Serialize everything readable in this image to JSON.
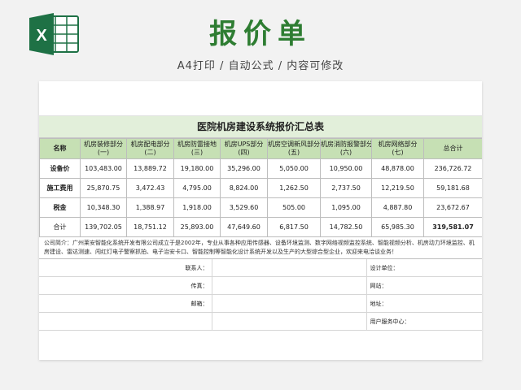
{
  "page": {
    "title": "报价单",
    "subtitle": "A4打印 / 自动公式 / 内容可修改",
    "excel_icon_letter": "X"
  },
  "sheet": {
    "table_title": "医院机房建设系统报价汇总表",
    "headers": [
      {
        "top": "名称",
        "bottom": ""
      },
      {
        "top": "机房装修部分",
        "bottom": "(一)"
      },
      {
        "top": "机房配电部分",
        "bottom": "(二)"
      },
      {
        "top": "机房防雷接地",
        "bottom": "(三)"
      },
      {
        "top": "机房UPS部分",
        "bottom": "(四)"
      },
      {
        "top": "机房空调新风部分",
        "bottom": "(五)"
      },
      {
        "top": "机房消防报警部分",
        "bottom": "(六)"
      },
      {
        "top": "机房网络部分",
        "bottom": "(七)"
      },
      {
        "top": "总合计",
        "bottom": ""
      }
    ],
    "rows": [
      {
        "label": "设备价",
        "values": [
          "103,483.00",
          "13,889.72",
          "19,180.00",
          "35,296.00",
          "5,050.00",
          "10,950.00",
          "48,878.00",
          "236,726.72"
        ]
      },
      {
        "label": "施工费用",
        "values": [
          "25,870.75",
          "3,472.43",
          "4,795.00",
          "8,824.00",
          "1,262.50",
          "2,737.50",
          "12,219.50",
          "59,181.68"
        ]
      },
      {
        "label": "税金",
        "values": [
          "10,348.30",
          "1,388.97",
          "1,918.00",
          "3,529.60",
          "505.00",
          "1,095.00",
          "4,887.80",
          "23,672.67"
        ]
      },
      {
        "label": "合计",
        "values": [
          "139,702.05",
          "18,751.12",
          "25,893.00",
          "47,649.60",
          "6,817.50",
          "14,782.50",
          "65,985.30",
          "319,581.07"
        ]
      }
    ],
    "note": "公司简介：广州莱安智能化系统开发有限公司成立于是2002年，专业从事各种应用传感器、设备环境监测、数字网络视频监控系统、智能视频分析、机房动力环境监控、机房建设、雷达测速、闯红灯电子警察抓拍、电子治安卡口、智能控制等智能化设计系统开发以及生产的大型综合型企业，欢迎来电洽谈业务！",
    "contact_labels": {
      "contact": "联系人：",
      "fax": "传真：",
      "email": "邮箱：",
      "design_unit": "设计单位：",
      "website": "网站：",
      "address": "地址：",
      "service_center": "用户服务中心："
    }
  },
  "colors": {
    "title_green": "#2e7d32",
    "header_green": "#c6e0b4",
    "title_band_green": "#e2efda",
    "excel_green": "#1e7145"
  }
}
